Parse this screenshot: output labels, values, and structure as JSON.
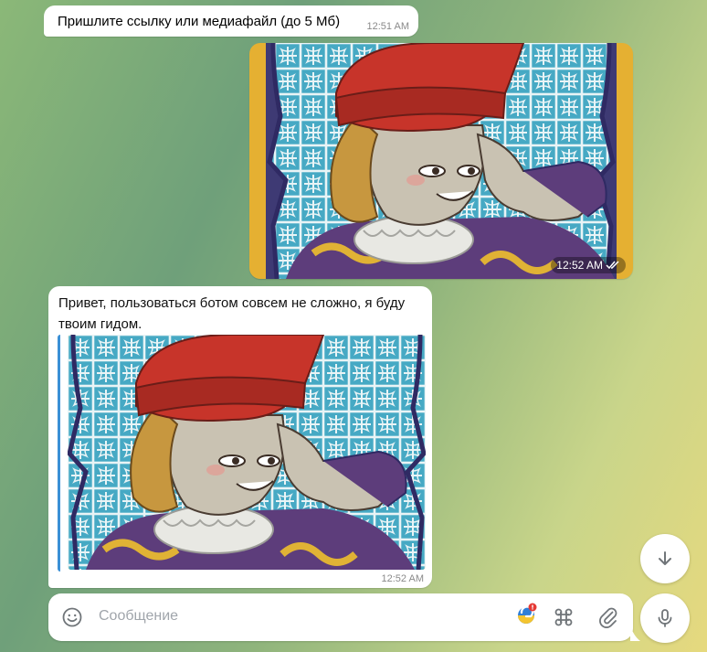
{
  "messages": [
    {
      "type": "text",
      "direction": "incoming",
      "text": "Пришлите ссылку или медиафайл (до 5 Мб)",
      "time": "12:51 AM"
    },
    {
      "type": "photo",
      "direction": "outgoing",
      "time": "12:52 AM",
      "status_icon": "double-check-icon"
    },
    {
      "type": "text_with_preview",
      "direction": "incoming",
      "text": "Привет, пользоваться ботом совсем не сложно, я буду твоим гидом.",
      "time": "12:52 AM"
    }
  ],
  "composer": {
    "placeholder": "Сообщение",
    "icons": [
      "emoji-icon",
      "bot-badge-icon",
      "command-icon",
      "attach-icon"
    ]
  },
  "buttons": {
    "scroll_down_icon": "arrow-down-icon",
    "voice_icon": "microphone-icon"
  },
  "colors": {
    "accent": "#3b90d6",
    "bubble_bg": "#ffffff",
    "time_text": "#8a8a8a"
  }
}
